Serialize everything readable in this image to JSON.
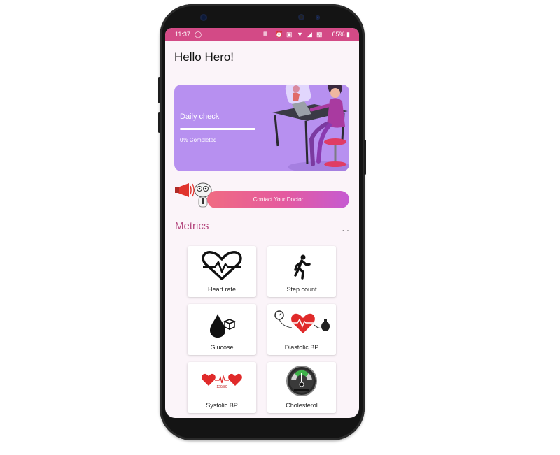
{
  "status_bar": {
    "time": "11:37",
    "battery": "65%"
  },
  "greeting": "Hello Hero!",
  "daily_check": {
    "title": "Daily check",
    "progress_label": "0% Completed",
    "progress": 0
  },
  "contact_button": "Contact Your Doctor",
  "metrics": {
    "title": "Metrics",
    "items": [
      {
        "label": "Heart rate",
        "icon": "heart-rate-icon"
      },
      {
        "label": "Step count",
        "icon": "walking-person-icon"
      },
      {
        "label": "Glucose",
        "icon": "glucose-drop-icon"
      },
      {
        "label": "Diastolic BP",
        "icon": "blood-pressure-heart-icon"
      },
      {
        "label": "Systolic BP",
        "icon": "hearts-pulse-icon"
      },
      {
        "label": "Cholesterol",
        "icon": "cholesterol-gauge-icon"
      }
    ]
  },
  "colors": {
    "status_bar": "#d34a86",
    "card": "#b790f0",
    "metrics_title": "#b54a80",
    "accent_gradient_start": "#f06b82",
    "accent_gradient_end": "#c55ad2"
  }
}
